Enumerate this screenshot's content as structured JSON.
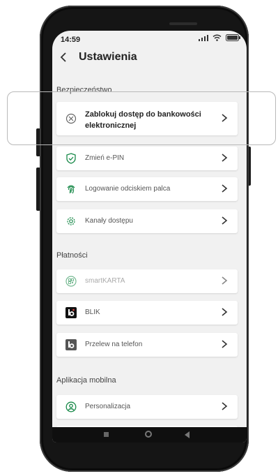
{
  "status_bar": {
    "time": "14:59"
  },
  "header": {
    "title": "Ustawienia"
  },
  "sections": {
    "security": "Bezpieczeństwo",
    "payments": "Płatności",
    "mobile_app": "Aplikacja mobilna"
  },
  "items": {
    "block_access": "Zablokuj dostęp do bankowości elektronicznej",
    "change_pin": "Zmień e-PIN",
    "fingerprint": "Logowanie odciskiem palca",
    "access_channels": "Kanały dostępu",
    "smartkarta": "smartKARTA",
    "blik": "BLIK",
    "phone_transfer": "Przelew na telefon",
    "personalization": "Personalizacja"
  },
  "colors": {
    "accent": "#1a8a4a",
    "card": "#ffffff",
    "background": "#f1f1f1"
  },
  "icons": {
    "block": "block-circle-icon",
    "pin": "shield-check-icon",
    "fingerprint": "fingerprint-icon",
    "channels": "gear-icon",
    "smartkarta": "qr-circle-icon",
    "blik": "blik-icon",
    "phone": "blik-outline-icon",
    "personalization": "user-circle-icon"
  }
}
